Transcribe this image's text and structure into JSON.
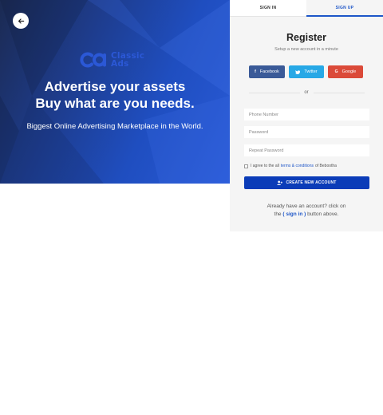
{
  "hero": {
    "back_icon": "arrow-left-icon",
    "logo_line1": "Classic",
    "logo_line2": "Ads",
    "title_line1": "Advertise your assets",
    "title_line2": "Buy what are you needs.",
    "subtitle": "Biggest Online Advertising Marketplace in the World.",
    "brand_color": "#2b58d6"
  },
  "tabs": [
    {
      "label": "SIGN IN",
      "active": false
    },
    {
      "label": "SIGN UP",
      "active": true
    }
  ],
  "register": {
    "title": "Register",
    "subtitle": "Setup a new account in a minute",
    "social": {
      "facebook": {
        "label": "Facebook",
        "icon": "facebook-icon",
        "color": "#3a5a98"
      },
      "twitter": {
        "label": "Twitter",
        "icon": "twitter-icon",
        "color": "#27a8e6"
      },
      "google": {
        "label": "Google",
        "icon": "google-icon",
        "color": "#db4a39"
      }
    },
    "divider_text": "or",
    "fields": {
      "phone_placeholder": "Phone Number",
      "password_placeholder": "Password",
      "repeat_password_placeholder": "Repeat Password"
    },
    "agree": {
      "prefix": "I agree to the all",
      "link": "terms & conditions",
      "suffix": "of Bebootha"
    },
    "create_button": {
      "label": "CREATE NEW ACCOUNT",
      "icon": "user-plus-icon",
      "color": "#0b3cb8"
    },
    "footer": {
      "line1": "Already have an account? click on",
      "prefix2": "the",
      "link": "( sign in )",
      "suffix2": "button above."
    }
  }
}
